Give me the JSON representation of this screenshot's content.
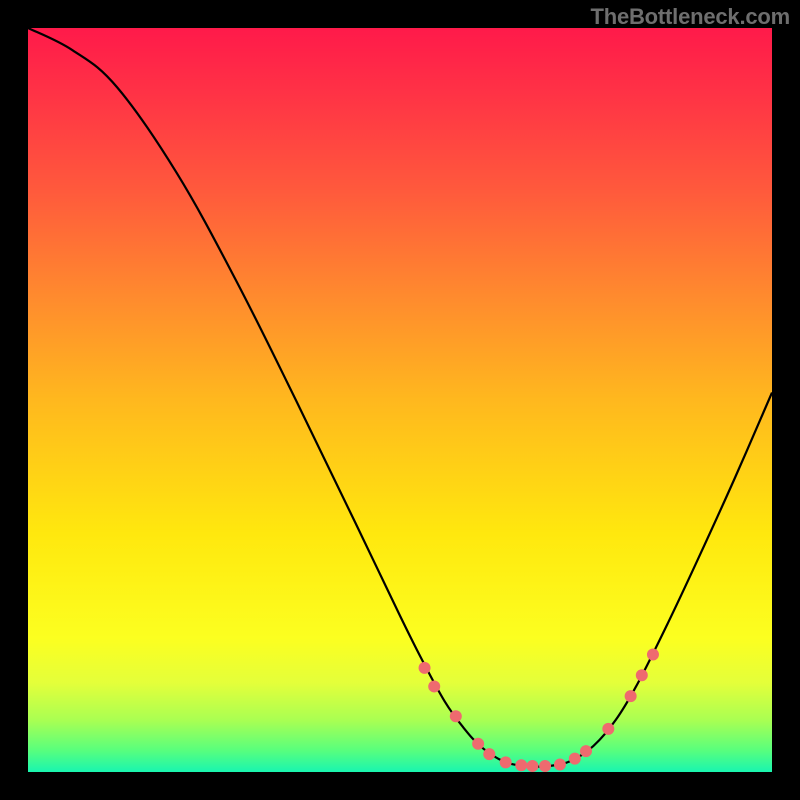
{
  "watermark": "TheBottleneck.com",
  "chart_data": {
    "type": "line",
    "title": "",
    "xlabel": "",
    "ylabel": "",
    "xlim": [
      0,
      100
    ],
    "ylim": [
      0,
      100
    ],
    "grid": false,
    "curve": {
      "points": [
        {
          "x": 0.0,
          "y": 100.0
        },
        {
          "x": 6.0,
          "y": 97.0
        },
        {
          "x": 12.0,
          "y": 92.0
        },
        {
          "x": 20.0,
          "y": 80.5
        },
        {
          "x": 28.0,
          "y": 66.0
        },
        {
          "x": 36.0,
          "y": 50.0
        },
        {
          "x": 44.0,
          "y": 33.5
        },
        {
          "x": 50.0,
          "y": 21.0
        },
        {
          "x": 53.0,
          "y": 15.0
        },
        {
          "x": 56.0,
          "y": 9.5
        },
        {
          "x": 58.5,
          "y": 6.0
        },
        {
          "x": 61.0,
          "y": 3.3
        },
        {
          "x": 64.0,
          "y": 1.4
        },
        {
          "x": 67.0,
          "y": 0.8
        },
        {
          "x": 70.0,
          "y": 0.8
        },
        {
          "x": 73.0,
          "y": 1.5
        },
        {
          "x": 76.0,
          "y": 3.5
        },
        {
          "x": 79.0,
          "y": 7.0
        },
        {
          "x": 82.0,
          "y": 12.0
        },
        {
          "x": 86.0,
          "y": 20.0
        },
        {
          "x": 90.0,
          "y": 28.5
        },
        {
          "x": 95.0,
          "y": 39.5
        },
        {
          "x": 100.0,
          "y": 51.0
        }
      ]
    },
    "markers": {
      "color": "#ef6a6f",
      "radius_px": 6,
      "points": [
        {
          "x": 53.3,
          "y": 14.0
        },
        {
          "x": 54.6,
          "y": 11.5
        },
        {
          "x": 57.5,
          "y": 7.5
        },
        {
          "x": 60.5,
          "y": 3.8
        },
        {
          "x": 62.0,
          "y": 2.4
        },
        {
          "x": 64.2,
          "y": 1.3
        },
        {
          "x": 66.3,
          "y": 0.9
        },
        {
          "x": 67.8,
          "y": 0.8
        },
        {
          "x": 69.5,
          "y": 0.8
        },
        {
          "x": 71.5,
          "y": 1.0
        },
        {
          "x": 73.5,
          "y": 1.8
        },
        {
          "x": 75.0,
          "y": 2.8
        },
        {
          "x": 78.0,
          "y": 5.8
        },
        {
          "x": 81.0,
          "y": 10.2
        },
        {
          "x": 82.5,
          "y": 13.0
        },
        {
          "x": 84.0,
          "y": 15.8
        }
      ]
    },
    "colors": {
      "curve": "#000000",
      "marker": "#ef6a6f",
      "frame": "#000000"
    }
  }
}
